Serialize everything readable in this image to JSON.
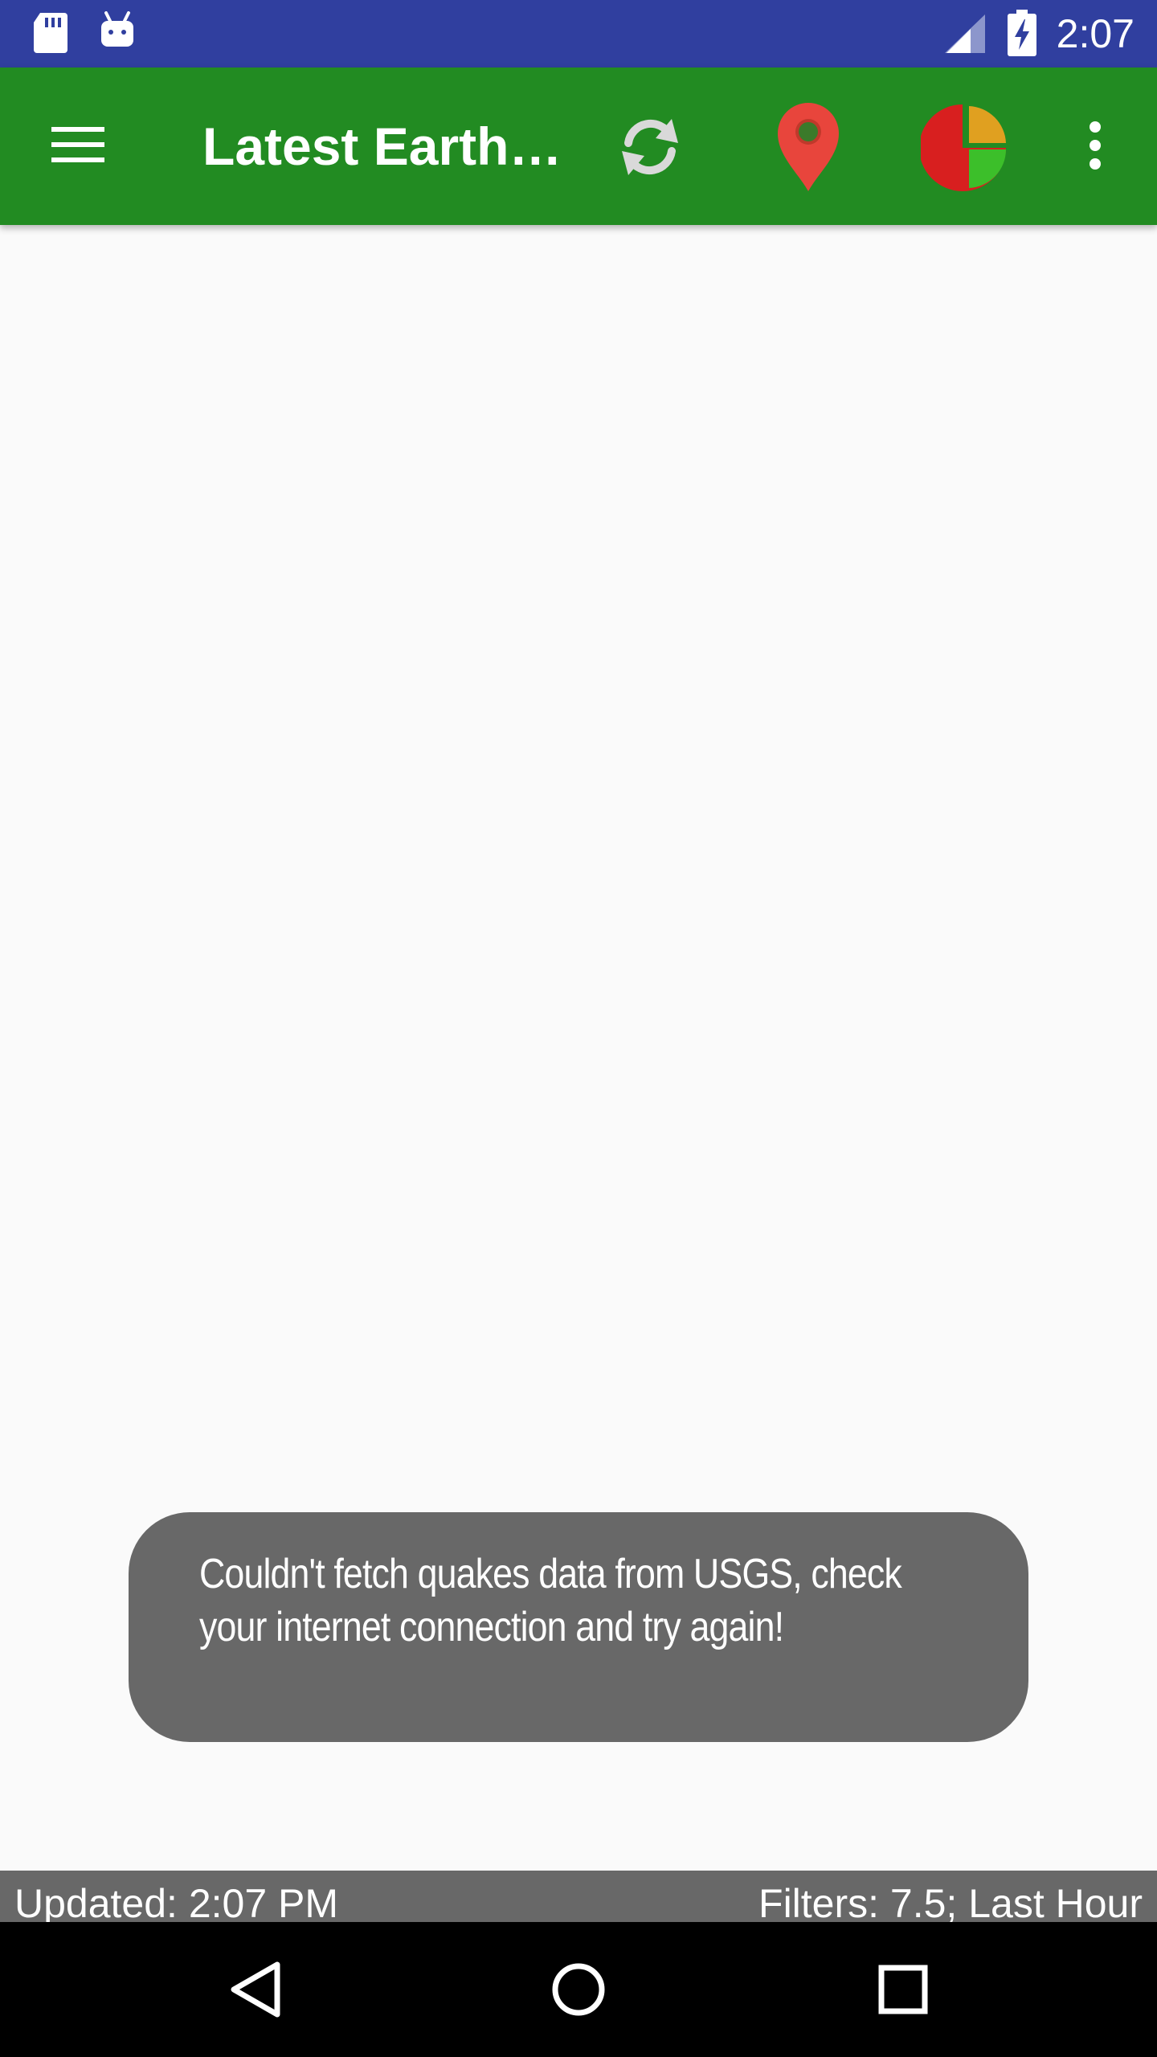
{
  "status_bar": {
    "time": "2:07",
    "icons": [
      "sd-card-icon",
      "android-debug-icon",
      "signal-icon",
      "battery-charging-icon"
    ],
    "color": "#303f9f"
  },
  "app_bar": {
    "title": "Latest Earth…",
    "color": "#228b22",
    "actions": [
      "menu-icon",
      "refresh-icon",
      "map-pin-icon",
      "pie-chart-icon",
      "more-vert-icon"
    ]
  },
  "toast": {
    "message": "Couldn't fetch quakes data from USGS, check your internet connection and try again!"
  },
  "footer": {
    "updated": "Updated: 2:07 PM",
    "filters": "Filters: 7.5; Last Hour"
  },
  "nav_bar": {
    "buttons": [
      "back-icon",
      "home-icon",
      "recents-icon"
    ]
  }
}
